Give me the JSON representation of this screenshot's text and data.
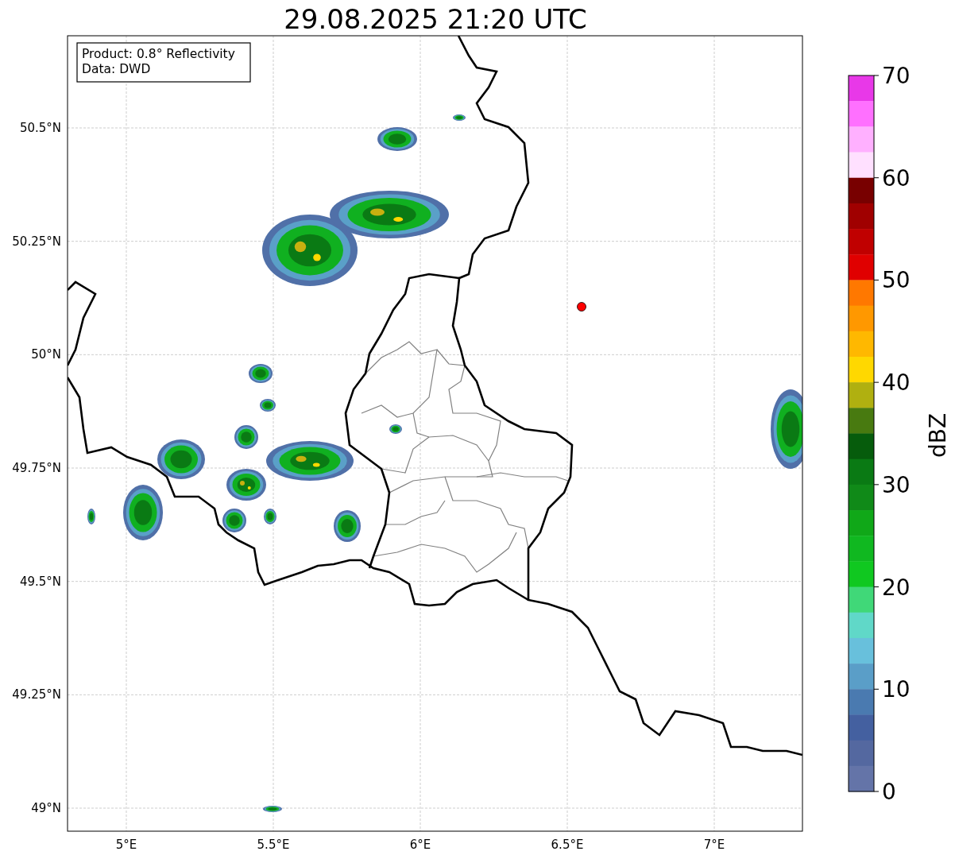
{
  "title": "29.08.2025 21:20 UTC",
  "info_box": [
    "Product: 0.8° Reflectivity",
    "Data: DWD"
  ],
  "map": {
    "y_ticks": [
      "50.5°N",
      "50.25°N",
      "50°N",
      "49.75°N",
      "49.5°N",
      "49.25°N",
      "49°N"
    ],
    "x_ticks": [
      "5°E",
      "5.5°E",
      "6°E",
      "6.5°E",
      "7°E"
    ]
  },
  "colorbar": {
    "label": "dBZ",
    "ticks": [
      "70",
      "60",
      "50",
      "40",
      "30",
      "20",
      "10",
      "0"
    ],
    "bins": [
      {
        "color": "#e838e8"
      },
      {
        "color": "#ff70ff"
      },
      {
        "color": "#ffb0ff"
      },
      {
        "color": "#ffe0ff"
      },
      {
        "color": "#780000"
      },
      {
        "color": "#a00000"
      },
      {
        "color": "#c00000"
      },
      {
        "color": "#e00000"
      },
      {
        "color": "#ff7800"
      },
      {
        "color": "#ff9800"
      },
      {
        "color": "#ffb800"
      },
      {
        "color": "#ffd800"
      },
      {
        "color": "#b0b010"
      },
      {
        "color": "#487a10"
      },
      {
        "color": "#065c0c"
      },
      {
        "color": "#0a7a14"
      },
      {
        "color": "#108a18"
      },
      {
        "color": "#10a818"
      },
      {
        "color": "#10b820"
      },
      {
        "color": "#10c820"
      },
      {
        "color": "#40d878"
      },
      {
        "color": "#60d8c8"
      },
      {
        "color": "#68c0dc"
      },
      {
        "color": "#5a9ec8"
      },
      {
        "color": "#4a7ab0"
      },
      {
        "color": "#4460a0"
      },
      {
        "color": "#5468a0"
      },
      {
        "color": "#6474a8"
      }
    ]
  }
}
